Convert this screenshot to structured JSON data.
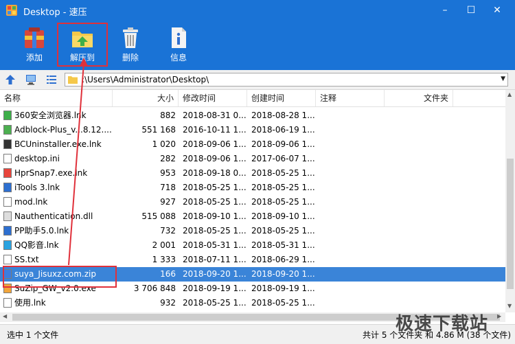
{
  "window": {
    "title": "Desktop - 速压",
    "min": "–",
    "max": "☐",
    "close": "✕"
  },
  "toolbar": {
    "add": "添加",
    "extract": "解压到",
    "delete": "删除",
    "info": "信息"
  },
  "address": {
    "path": ":\\Users\\Administrator\\Desktop\\"
  },
  "columns": {
    "name": "名称",
    "size": "大小",
    "modified": "修改时间",
    "created": "创建时间",
    "comment": "注释",
    "folder": "文件夹"
  },
  "files": [
    {
      "name": "360安全浏览器.lnk",
      "size": "882",
      "modified": "2018-08-31 0...",
      "created": "2018-08-28 1...",
      "icon": "browser-360-icon"
    },
    {
      "name": "Adblock-Plus_v...8.12....",
      "size": "551 168",
      "modified": "2016-10-11 1...",
      "created": "2018-06-19 1...",
      "icon": "exe-icon"
    },
    {
      "name": "BCUninstaller.exe.lnk",
      "size": "1 020",
      "modified": "2018-09-06 1...",
      "created": "2018-09-06 1...",
      "icon": "bc-icon"
    },
    {
      "name": "desktop.ini",
      "size": "282",
      "modified": "2018-09-06 1...",
      "created": "2017-06-07 1...",
      "icon": "file-icon"
    },
    {
      "name": "HprSnap7.exe.lnk",
      "size": "953",
      "modified": "2018-09-18 0...",
      "created": "2018-05-25 1...",
      "icon": "snap-icon"
    },
    {
      "name": "iTools 3.lnk",
      "size": "718",
      "modified": "2018-05-25 1...",
      "created": "2018-05-25 1...",
      "icon": "itools-icon"
    },
    {
      "name": "mod.lnk",
      "size": "927",
      "modified": "2018-05-25 1...",
      "created": "2018-05-25 1...",
      "icon": "file-icon"
    },
    {
      "name": "Nauthentication.dll",
      "size": "515 088",
      "modified": "2018-09-10 1...",
      "created": "2018-09-10 1...",
      "icon": "dll-icon"
    },
    {
      "name": "PP助手5.0.lnk",
      "size": "732",
      "modified": "2018-05-25 1...",
      "created": "2018-05-25 1...",
      "icon": "pp-icon"
    },
    {
      "name": "QQ影音.lnk",
      "size": "2 001",
      "modified": "2018-05-31 1...",
      "created": "2018-05-31 1...",
      "icon": "qq-icon"
    },
    {
      "name": "SS.txt",
      "size": "1 333",
      "modified": "2018-07-11 1...",
      "created": "2018-06-29 1...",
      "icon": "txt-icon"
    },
    {
      "name": "suya_Jisuxz.com.zip",
      "size": "166",
      "modified": "2018-09-20 1...",
      "created": "2018-09-20 1...",
      "icon": "zip-icon",
      "selected": true
    },
    {
      "name": "SuZip_GW_v2.0.exe",
      "size": "3 706 848",
      "modified": "2018-09-19 1...",
      "created": "2018-09-19 1...",
      "icon": "suzip-icon"
    },
    {
      "name": "使用.lnk",
      "size": "932",
      "modified": "2018-05-25 1...",
      "created": "2018-05-25 1...",
      "icon": "file-icon"
    }
  ],
  "status": {
    "left": "选中 1 个文件",
    "right": "共计 5 个文件夹 和 4.86 M (38 个文件)"
  },
  "watermark": "极速下载站",
  "colors": {
    "titlebar": "#1a73d6",
    "selection": "#3a84d8",
    "highlight": "#e0303a"
  }
}
